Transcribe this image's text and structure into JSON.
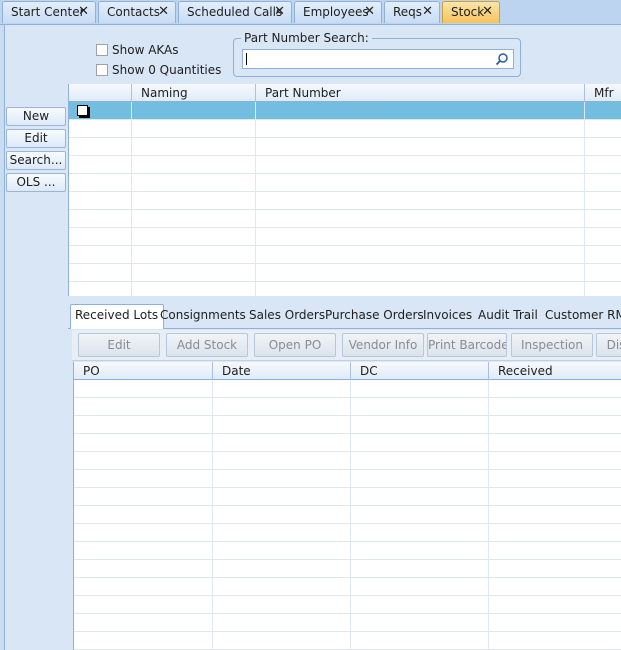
{
  "tabs": [
    {
      "label": "Start Center",
      "active": false
    },
    {
      "label": "Contacts",
      "active": false
    },
    {
      "label": "Scheduled Calls",
      "active": false
    },
    {
      "label": "Employees",
      "active": false
    },
    {
      "label": "Reqs",
      "active": false
    },
    {
      "label": "Stock",
      "active": true
    }
  ],
  "filters": {
    "show_akas": "Show AKAs",
    "show_zero": "Show 0 Quantities"
  },
  "part_search": {
    "legend": "Part Number Search:",
    "value": ""
  },
  "side_buttons": {
    "new": "New",
    "edit": "Edit",
    "search": "Search...",
    "ols": "OLS ..."
  },
  "top_grid": {
    "columns": [
      "",
      "Naming",
      "Part Number",
      "Mfr"
    ]
  },
  "detail_tabs": [
    "Received Lots",
    "Consignments",
    "Sales Orders",
    "Purchase Orders",
    "Invoices",
    "Audit Trail",
    "Customer RMA"
  ],
  "actions": {
    "edit": "Edit",
    "add_stock": "Add Stock",
    "open_po": "Open PO",
    "vendor_info": "Vendor Info",
    "print_barcode": "Print Barcode",
    "inspection": "Inspection",
    "dis": "Dis"
  },
  "bottom_grid": {
    "columns": [
      "PO",
      "Date",
      "DC",
      "Received"
    ]
  },
  "colors": {
    "selected_row": "#73bde0",
    "active_tab": "#f4c45b"
  }
}
